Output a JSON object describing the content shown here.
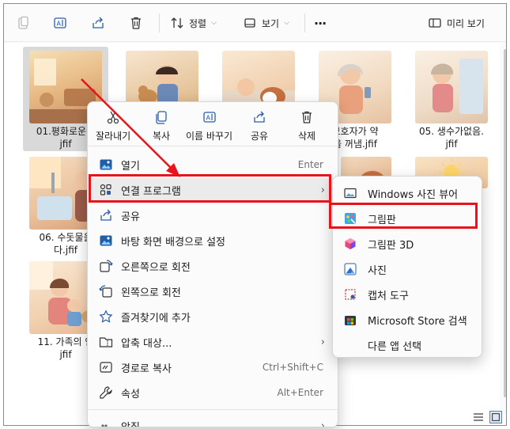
{
  "toolbar": {
    "sort_label": "정렬",
    "view_label": "보기",
    "more_label": "···",
    "preview_label": "미리 보기"
  },
  "files": [
    {
      "name": "01.평화로운아\njfif"
    },
    {
      "name": ""
    },
    {
      "name": ""
    },
    {
      "name": "보호자가 약\n을 꺼냄.jfif"
    },
    {
      "name": "05. 생수가없음.\njfif"
    },
    {
      "name": "06. 수돗물을\n다.jfif"
    },
    {
      "name": "11. 가족의 안\njfif"
    }
  ],
  "context_menu": {
    "actions": [
      {
        "label": "잘라내기",
        "icon": "scissors-icon"
      },
      {
        "label": "복사",
        "icon": "copy-icon"
      },
      {
        "label": "이름 바꾸기",
        "icon": "rename-icon"
      },
      {
        "label": "공유",
        "icon": "share-icon"
      },
      {
        "label": "삭제",
        "icon": "trash-icon"
      }
    ],
    "items": [
      {
        "label": "열기",
        "shortcut": "Enter"
      },
      {
        "label": "연결 프로그램",
        "shortcut": "",
        "arrow": "›"
      },
      {
        "label": "공유",
        "shortcut": ""
      },
      {
        "label": "바탕 화면 배경으로 설정",
        "shortcut": ""
      },
      {
        "label": "오른쪽으로 회전",
        "shortcut": ""
      },
      {
        "label": "왼쪽으로 회전",
        "shortcut": ""
      },
      {
        "label": "즐겨찾기에 추가",
        "shortcut": ""
      },
      {
        "label": "압축 대상...",
        "shortcut": "",
        "arrow": "›"
      },
      {
        "label": "경로로 복사",
        "shortcut": "Ctrl+Shift+C"
      },
      {
        "label": "속성",
        "shortcut": "Alt+Enter"
      },
      {
        "label": "앙집",
        "shortcut": "",
        "arrow": "›"
      }
    ]
  },
  "submenu": {
    "items": [
      {
        "label": "Windows 사진 뷰어",
        "icon": "photo-viewer-icon"
      },
      {
        "label": "그림판",
        "icon": "paint-icon"
      },
      {
        "label": "그림판 3D",
        "icon": "paint3d-icon"
      },
      {
        "label": "사진",
        "icon": "photos-icon"
      },
      {
        "label": "캡처 도구",
        "icon": "snipping-tool-icon"
      },
      {
        "label": "Microsoft Store 검색",
        "icon": "store-icon"
      },
      {
        "label": "다른 앱 선택",
        "icon": ""
      }
    ]
  },
  "colors": {
    "highlight_red": "#e8141b",
    "accent_blue": "#0067c0"
  }
}
